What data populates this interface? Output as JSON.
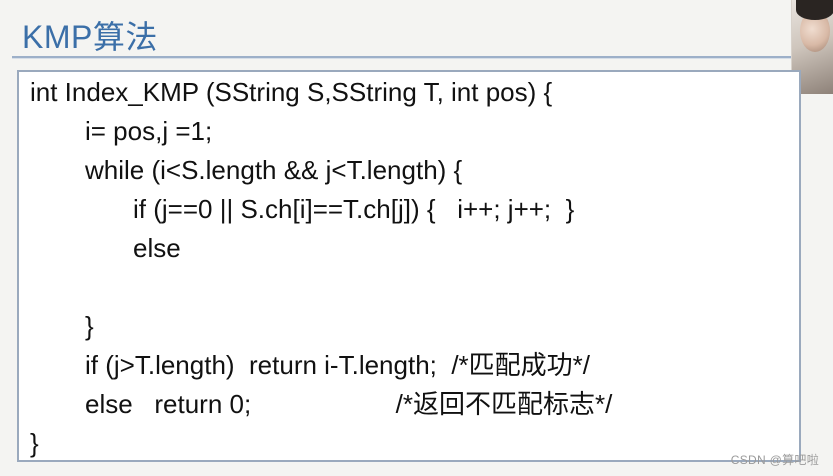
{
  "slide": {
    "title": "KMP算法",
    "code_lines": [
      "int Index_KMP (SString S,SString T, int pos) {",
      "i= pos,j =1;",
      "while (i<S.length && j<T.length) {",
      "if (j==0 || S.ch[i]==T.ch[j]) {   i++; j++;  }",
      "else",
      "",
      "}",
      "if (j>T.length)  return i-T.length;  /*匹配成功*/",
      "else   return 0;                    /*返回不匹配标志*/",
      "}"
    ]
  },
  "watermark": "CSDN @算吧啦",
  "colors": {
    "title": "#3b6fa8",
    "rule": "#9db0c9",
    "box_border": "#9aa9bd",
    "code_text": "#111111"
  }
}
